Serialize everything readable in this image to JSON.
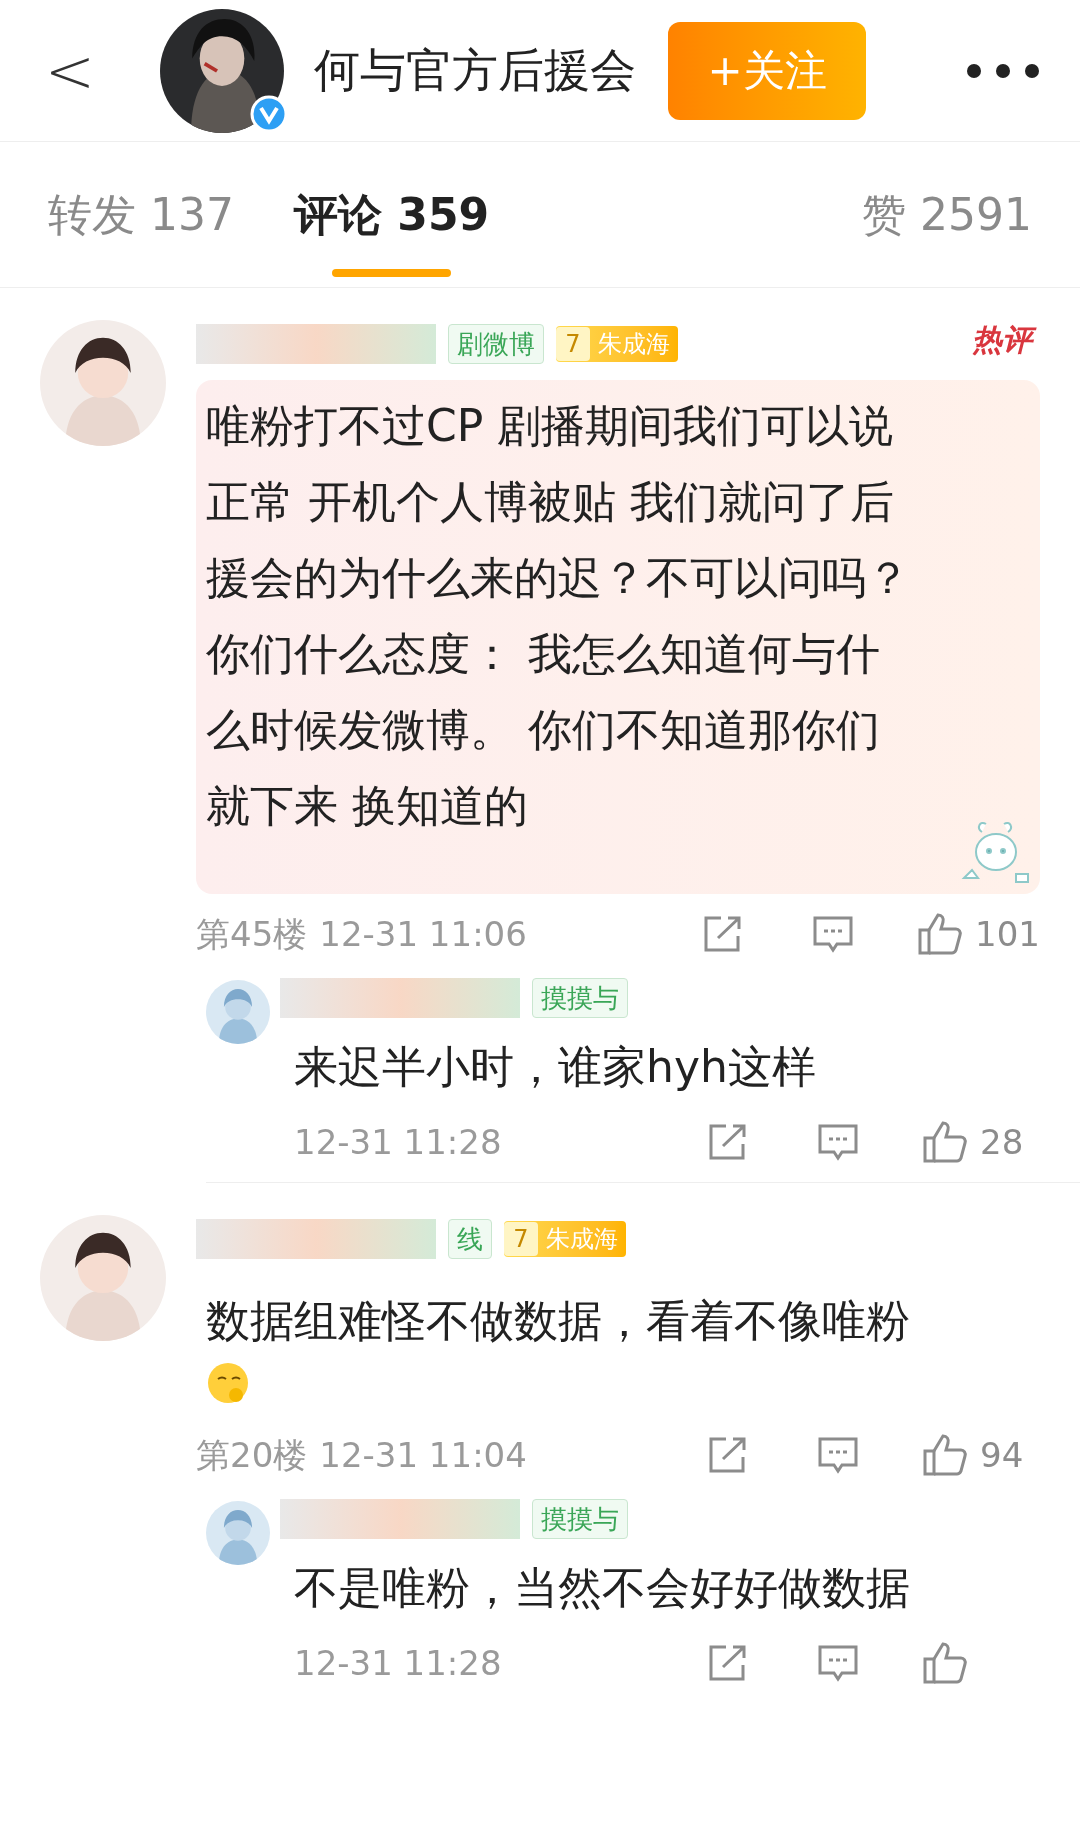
{
  "header": {
    "back": "<",
    "title": "何与官方后援会",
    "verified": true,
    "follow_button": "+关注"
  },
  "tabs": [
    {
      "label": "转发 137",
      "selected": false
    },
    {
      "label": "评论 359",
      "selected": true
    },
    {
      "label": "赞 2591",
      "selected": false
    }
  ],
  "comments": [
    {
      "badges": [
        {
          "kind": "tag",
          "text": "剧微博"
        },
        {
          "kind": "level",
          "level": "7",
          "text": "朱成海"
        }
      ],
      "hot": true,
      "hot_label": "热评",
      "text": "唯粉打不过CP 剧播期间我们可以说正常 开机个人博被贴 我们就问了后援会的为什么来的迟？不可以问吗？你们什么态度： 我怎么知道何与什么时候发微博。 你们不知道那你们就下来 换知道的",
      "decorations": [
        {
          "kind": "sticker"
        }
      ],
      "floor": "第45楼",
      "time": "12-31 11:06",
      "likes": "101",
      "replies": [
        {
          "badges": [
            {
              "kind": "tag",
              "text": "摸摸与"
            }
          ],
          "text": "来迟半小时，谁家hyh这样",
          "time": "12-31 11:28",
          "likes": "28"
        }
      ]
    },
    {
      "badges": [
        {
          "kind": "tag",
          "text": "线"
        },
        {
          "kind": "level",
          "level": "7",
          "text": "朱成海"
        }
      ],
      "hot": false,
      "text": "数据组难怪不做数据，看着不像唯粉",
      "decorations": [
        {
          "kind": "emoji"
        }
      ],
      "floor": "第20楼",
      "time": "12-31 11:04",
      "likes": "94",
      "replies": [
        {
          "badges": [
            {
              "kind": "tag",
              "text": "摸摸与"
            }
          ],
          "text": "不是唯粉，当然不会好好做数据",
          "time": "12-31 11:28"
        }
      ]
    }
  ]
}
